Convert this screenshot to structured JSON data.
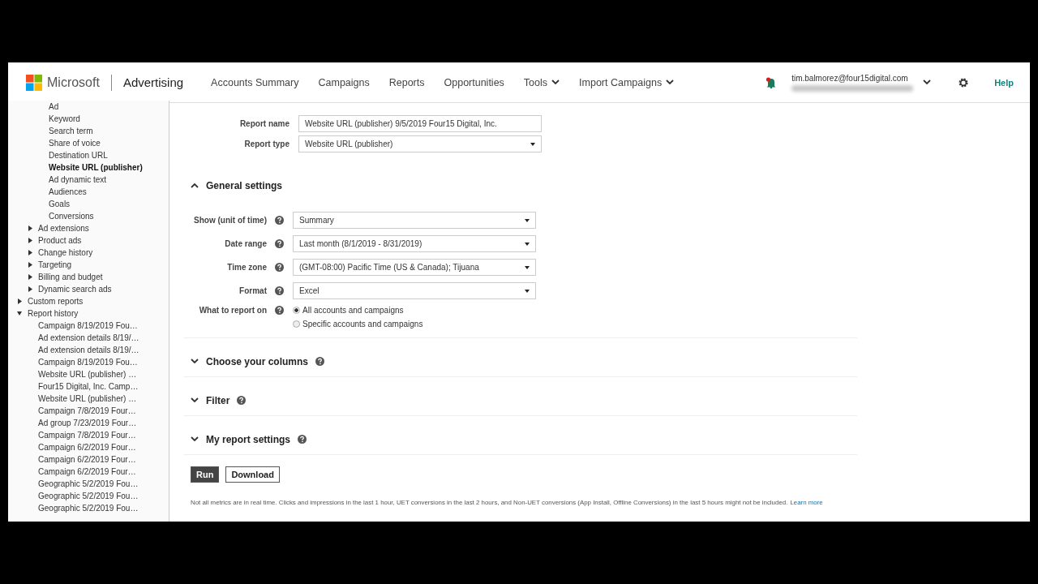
{
  "header": {
    "brand": "Microsoft",
    "product": "Advertising",
    "nav": [
      {
        "label": "Accounts Summary",
        "menu": false
      },
      {
        "label": "Campaigns",
        "menu": false
      },
      {
        "label": "Reports",
        "menu": false
      },
      {
        "label": "Opportunities",
        "menu": false
      },
      {
        "label": "Tools",
        "menu": true
      },
      {
        "label": "Import Campaigns",
        "menu": true
      }
    ],
    "notification": true,
    "user_email": "tim.balmorez@four15digital.com",
    "help": "Help"
  },
  "sidebar": {
    "items": [
      {
        "children": [
          {
            "children": [
              {
                "label": "Ad",
                "selected": false
              },
              {
                "label": "Keyword",
                "selected": false
              },
              {
                "label": "Search term",
                "selected": false
              },
              {
                "label": "Share of voice",
                "selected": false
              },
              {
                "label": "Destination URL",
                "selected": false
              },
              {
                "label": "Website URL (publisher)",
                "selected": true
              },
              {
                "label": "Ad dynamic text",
                "selected": false
              },
              {
                "label": "Audiences",
                "selected": false
              },
              {
                "label": "Goals",
                "selected": false
              },
              {
                "label": "Conversions",
                "selected": false
              }
            ]
          },
          {
            "label": "Ad extensions",
            "expanded": false,
            "selected": false
          },
          {
            "label": "Product ads",
            "expanded": false,
            "selected": false
          },
          {
            "label": "Change history",
            "expanded": false,
            "selected": false
          },
          {
            "label": "Targeting",
            "expanded": false,
            "selected": false
          },
          {
            "label": "Billing and budget",
            "expanded": false,
            "selected": false
          },
          {
            "label": "Dynamic search ads",
            "expanded": false,
            "selected": false
          }
        ]
      },
      {
        "label": "Custom reports",
        "expanded": false,
        "selected": false
      },
      {
        "label": "Report history",
        "expanded": true,
        "selected": false,
        "children": [
          {
            "label": "Campaign 8/19/2019 Fou…",
            "selected": false
          },
          {
            "label": "Ad extension details 8/19/…",
            "selected": false
          },
          {
            "label": "Ad extension details 8/19/…",
            "selected": false
          },
          {
            "label": "Campaign 8/19/2019 Fou…",
            "selected": false
          },
          {
            "label": "Website URL (publisher) …",
            "selected": false
          },
          {
            "label": "Four15 Digital, Inc. Camp…",
            "selected": false
          },
          {
            "label": "Website URL (publisher) …",
            "selected": false
          },
          {
            "label": "Campaign 7/8/2019 Four…",
            "selected": false
          },
          {
            "label": "Ad group 7/23/2019 Four…",
            "selected": false
          },
          {
            "label": "Campaign 7/8/2019 Four…",
            "selected": false
          },
          {
            "label": "Campaign 6/2/2019 Four…",
            "selected": false
          },
          {
            "label": "Campaign 6/2/2019 Four…",
            "selected": false
          },
          {
            "label": "Campaign 6/2/2019 Four…",
            "selected": false
          },
          {
            "label": "Geographic 5/2/2019 Fou…",
            "selected": false
          },
          {
            "label": "Geographic 5/2/2019 Fou…",
            "selected": false
          },
          {
            "label": "Geographic 5/2/2019 Fou…",
            "selected": false
          }
        ]
      }
    ]
  },
  "form": {
    "top_fields": [
      {
        "label": "Report name",
        "kind": "text",
        "value": "Website URL (publisher) 9/5/2019 Four15 Digital, Inc.",
        "help": false
      },
      {
        "label": "Report type",
        "kind": "select",
        "value": "Website URL (publisher)",
        "help": false
      }
    ],
    "sections": [
      {
        "title": "General settings",
        "expanded": true,
        "help": false,
        "fields": [
          {
            "label": "Show (unit of time)",
            "kind": "select",
            "value": "Summary",
            "help": true
          },
          {
            "label": "Date range",
            "kind": "select",
            "value": "Last month (8/1/2019 - 8/31/2019)",
            "help": true
          },
          {
            "label": "Time zone",
            "kind": "select",
            "value": "(GMT-08:00) Pacific Time (US & Canada); Tijuana",
            "help": true
          },
          {
            "label": "Format",
            "kind": "select",
            "value": "Excel",
            "help": true
          },
          {
            "label": "What to report on",
            "kind": "radio",
            "help": true,
            "options": [
              {
                "label": "All accounts and campaigns",
                "selected": true
              },
              {
                "label": "Specific accounts and campaigns",
                "selected": false
              }
            ]
          }
        ]
      },
      {
        "title": "Choose your columns",
        "expanded": false,
        "help": true
      },
      {
        "title": "Filter",
        "expanded": false,
        "help": true
      },
      {
        "title": "My report settings",
        "expanded": false,
        "help": true
      }
    ],
    "buttons": [
      {
        "label": "Run",
        "primary": true
      },
      {
        "label": "Download",
        "primary": false
      }
    ],
    "note": "Not all metrics are in real time. Clicks and impressions in the last 1 hour, UET conversions in the last 2 hours, and Non-UET conversions (App Install, Offline Conversions) in the last 5 hours might not be included.",
    "note_link": "Learn more"
  }
}
